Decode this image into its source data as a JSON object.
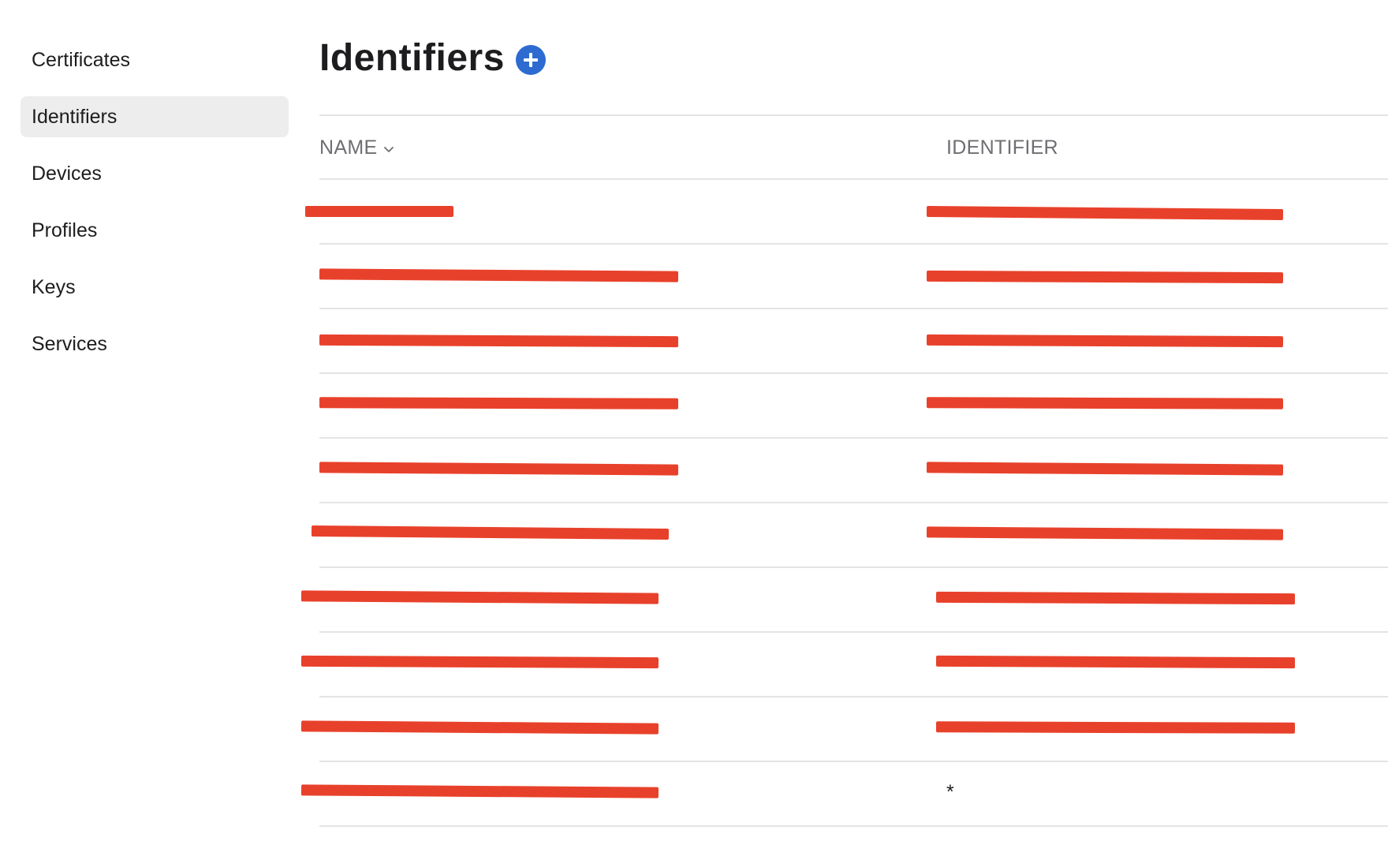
{
  "sidebar": {
    "items": [
      {
        "label": "Certificates",
        "active": false
      },
      {
        "label": "Identifiers",
        "active": true
      },
      {
        "label": "Devices",
        "active": false
      },
      {
        "label": "Profiles",
        "active": false
      },
      {
        "label": "Keys",
        "active": false
      },
      {
        "label": "Services",
        "active": false
      }
    ]
  },
  "main": {
    "title": "Identifiers",
    "add_icon": "plus-circle-icon",
    "accent_color": "#2d6bd1",
    "redaction_color": "#e8412b"
  },
  "table": {
    "columns": {
      "name": "NAME",
      "identifier": "IDENTIFIER"
    },
    "sort_icon": "chevron-down-icon",
    "rows": [
      {
        "name": "",
        "identifier": ""
      },
      {
        "name": "",
        "identifier": ""
      },
      {
        "name": "",
        "identifier": ""
      },
      {
        "name": "",
        "identifier": ""
      },
      {
        "name": "",
        "identifier": ""
      },
      {
        "name": "",
        "identifier": ""
      },
      {
        "name": "",
        "identifier": ""
      },
      {
        "name": "",
        "identifier": ""
      },
      {
        "name": "",
        "identifier": ""
      },
      {
        "name": "",
        "identifier": "*"
      }
    ]
  }
}
